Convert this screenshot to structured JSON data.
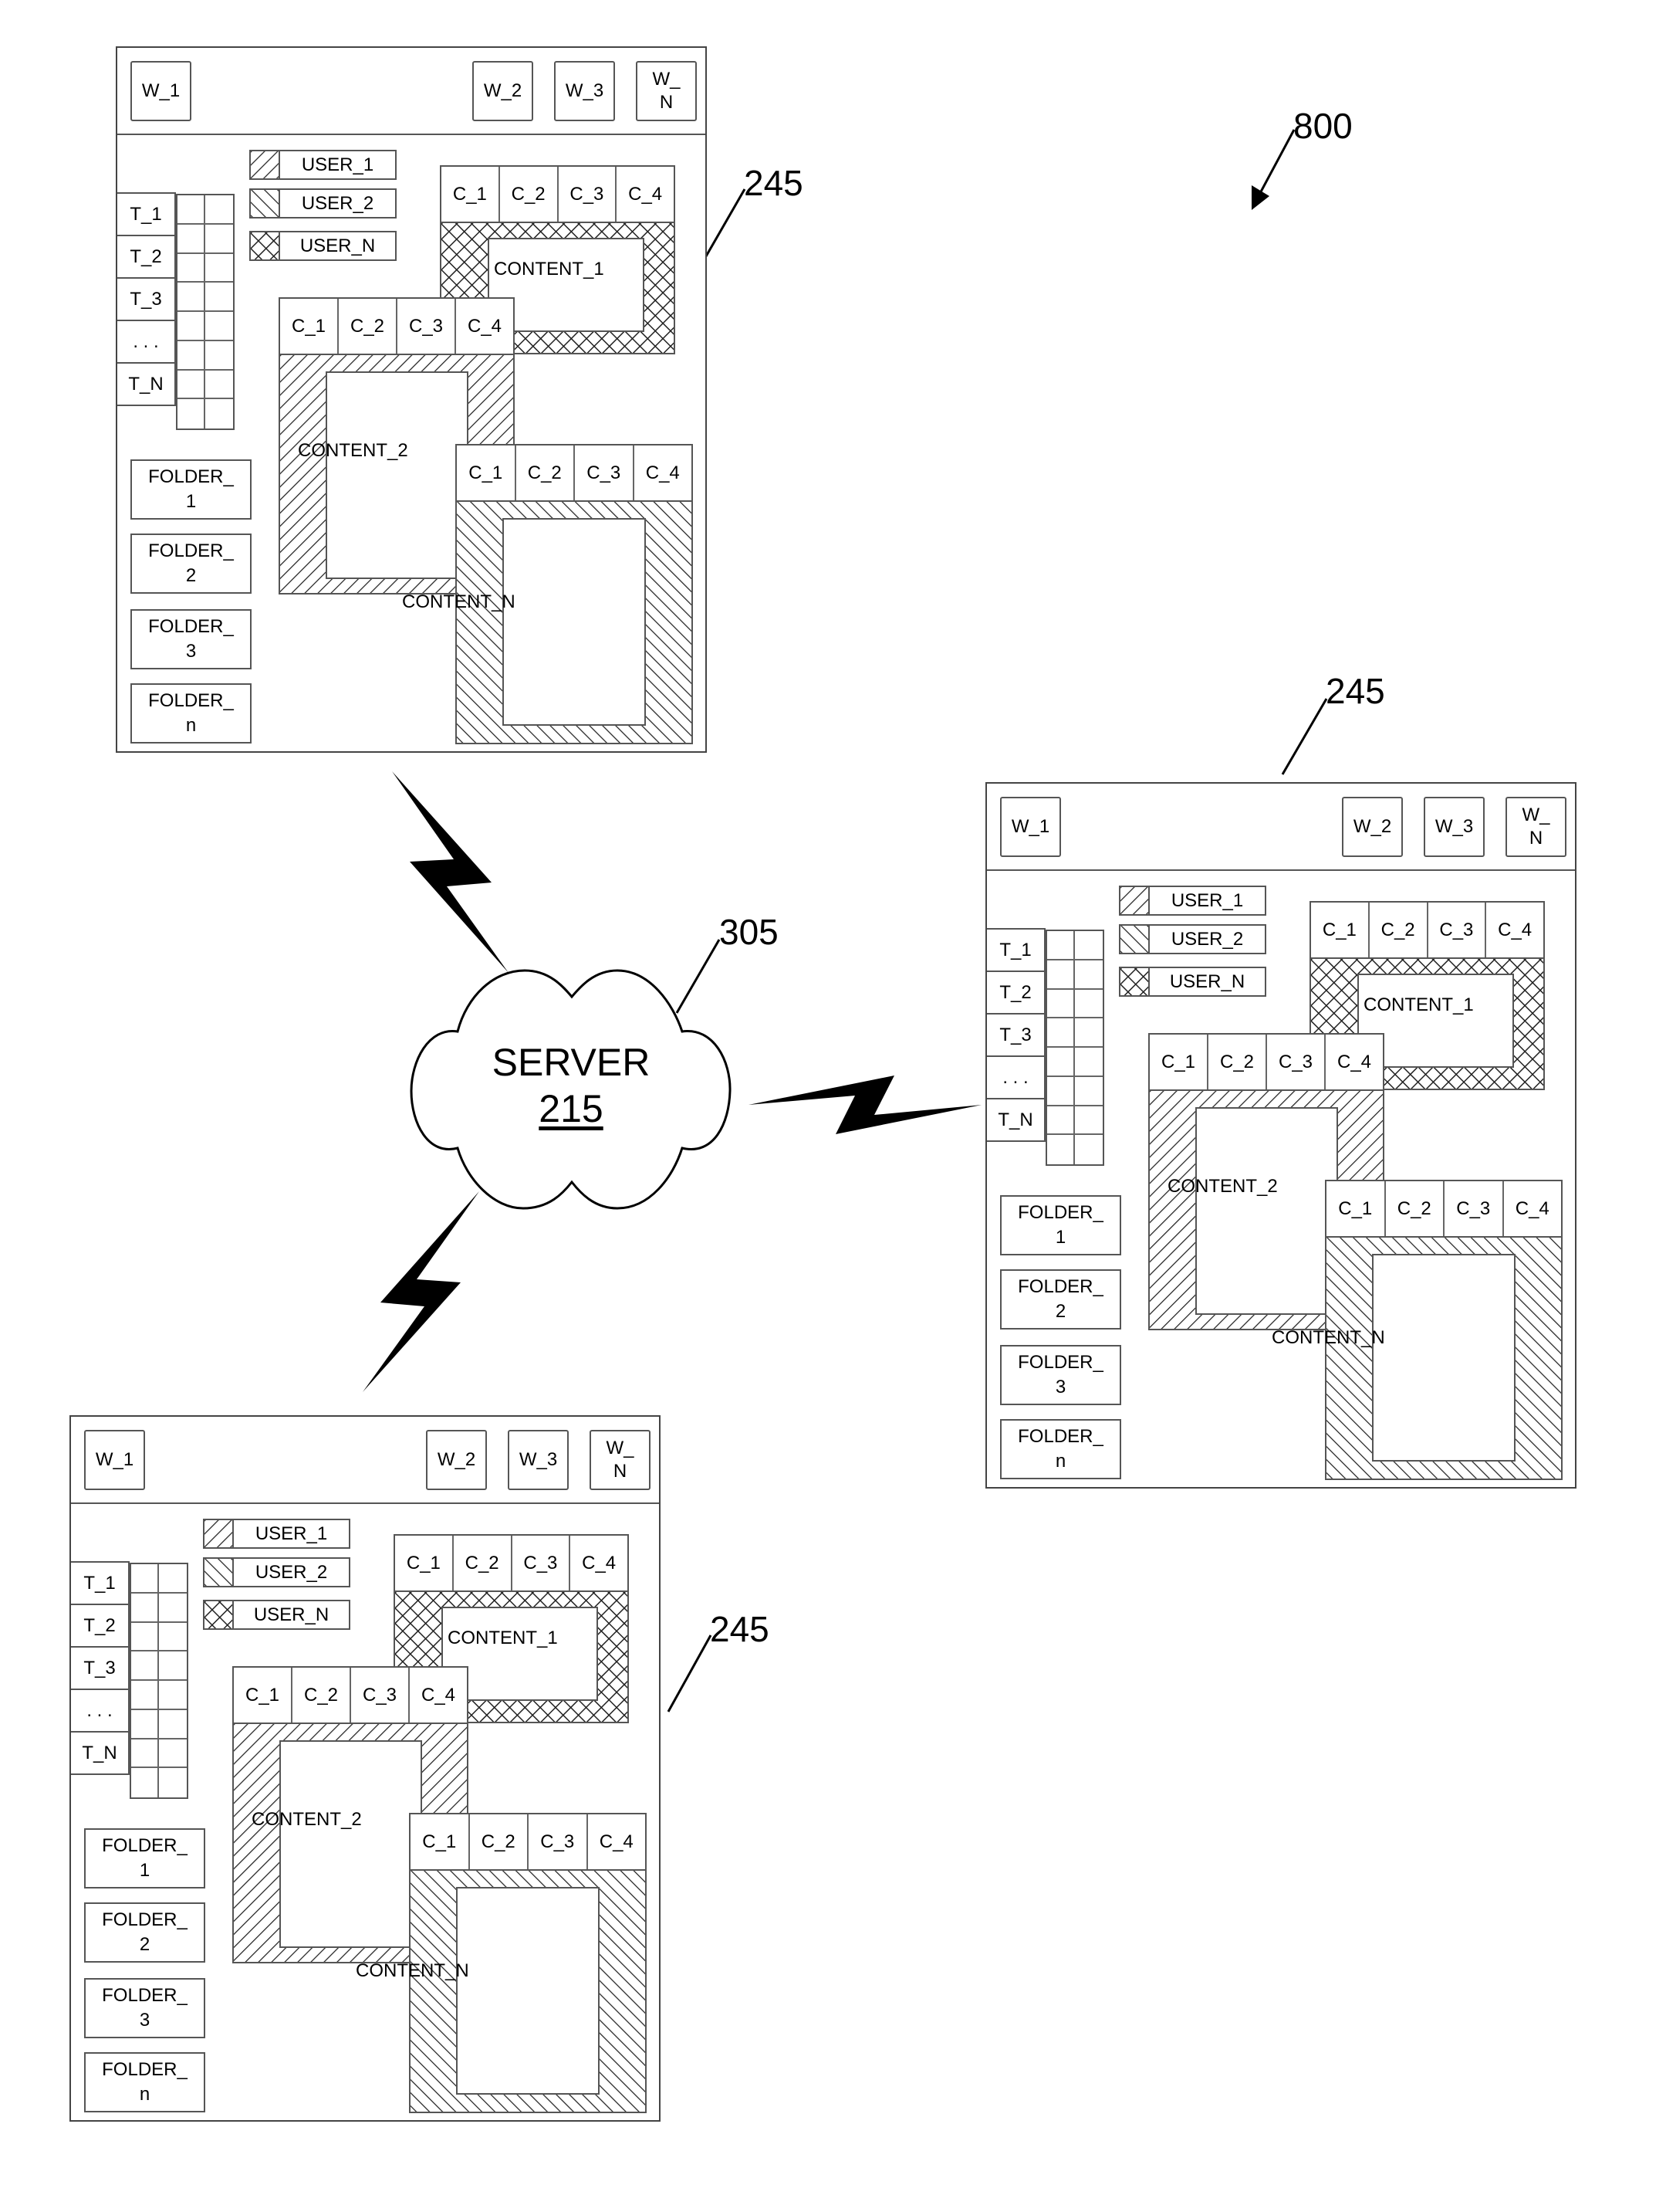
{
  "figure": {
    "label": "800",
    "server": {
      "title": "SERVER",
      "number": "215",
      "cloud_ref": "305"
    },
    "window_ref": "245"
  },
  "windows": [
    {
      "id": "top-left",
      "header_buttons": [
        "W_1",
        "W_2",
        "W_3",
        "W_\nN"
      ],
      "users": [
        {
          "label": "USER_1",
          "pattern": "hatch-right"
        },
        {
          "label": "USER_2",
          "pattern": "hatch-left"
        },
        {
          "label": "USER_N",
          "pattern": "crosshatch"
        }
      ],
      "tabs": [
        "T_1",
        "T_2",
        "T_3",
        ". . .",
        "T_N"
      ],
      "folders": [
        "FOLDER_\n1",
        "FOLDER_\n2",
        "FOLDER_\n3",
        "FOLDER_\nn"
      ],
      "contents": [
        {
          "label": "CONTENT_1",
          "columns": [
            "C_1",
            "C_2",
            "C_3",
            "C_4"
          ],
          "owner_pattern": "crosshatch"
        },
        {
          "label": "CONTENT_2",
          "columns": [
            "C_1",
            "C_2",
            "C_3",
            "C_4"
          ],
          "owner_pattern": "hatch-right"
        },
        {
          "label": "CONTENT_N",
          "columns": [
            "C_1",
            "C_2",
            "C_3",
            "C_4"
          ],
          "owner_pattern": "hatch-left"
        }
      ]
    },
    {
      "id": "right",
      "header_buttons": [
        "W_1",
        "W_2",
        "W_3",
        "W_\nN"
      ],
      "users": [
        {
          "label": "USER_1",
          "pattern": "hatch-right"
        },
        {
          "label": "USER_2",
          "pattern": "hatch-left"
        },
        {
          "label": "USER_N",
          "pattern": "crosshatch"
        }
      ],
      "tabs": [
        "T_1",
        "T_2",
        "T_3",
        ". . .",
        "T_N"
      ],
      "folders": [
        "FOLDER_\n1",
        "FOLDER_\n2",
        "FOLDER_\n3",
        "FOLDER_\nn"
      ],
      "contents": [
        {
          "label": "CONTENT_1",
          "columns": [
            "C_1",
            "C_2",
            "C_3",
            "C_4"
          ],
          "owner_pattern": "crosshatch"
        },
        {
          "label": "CONTENT_2",
          "columns": [
            "C_1",
            "C_2",
            "C_3",
            "C_4"
          ],
          "owner_pattern": "hatch-right"
        },
        {
          "label": "CONTENT_N",
          "columns": [
            "C_1",
            "C_2",
            "C_3",
            "C_4"
          ],
          "owner_pattern": "hatch-left"
        }
      ]
    },
    {
      "id": "bottom-left",
      "header_buttons": [
        "W_1",
        "W_2",
        "W_3",
        "W_\nN"
      ],
      "users": [
        {
          "label": "USER_1",
          "pattern": "hatch-right"
        },
        {
          "label": "USER_2",
          "pattern": "hatch-left"
        },
        {
          "label": "USER_N",
          "pattern": "crosshatch"
        }
      ],
      "tabs": [
        "T_1",
        "T_2",
        "T_3",
        ". . .",
        "T_N"
      ],
      "folders": [
        "FOLDER_\n1",
        "FOLDER_\n2",
        "FOLDER_\n3",
        "FOLDER_\nn"
      ],
      "contents": [
        {
          "label": "CONTENT_1",
          "columns": [
            "C_1",
            "C_2",
            "C_3",
            "C_4"
          ],
          "owner_pattern": "crosshatch"
        },
        {
          "label": "CONTENT_2",
          "columns": [
            "C_1",
            "C_2",
            "C_3",
            "C_4"
          ],
          "owner_pattern": "hatch-right"
        },
        {
          "label": "CONTENT_N",
          "columns": [
            "C_1",
            "C_2",
            "C_3",
            "C_4"
          ],
          "owner_pattern": "hatch-left"
        }
      ]
    }
  ]
}
